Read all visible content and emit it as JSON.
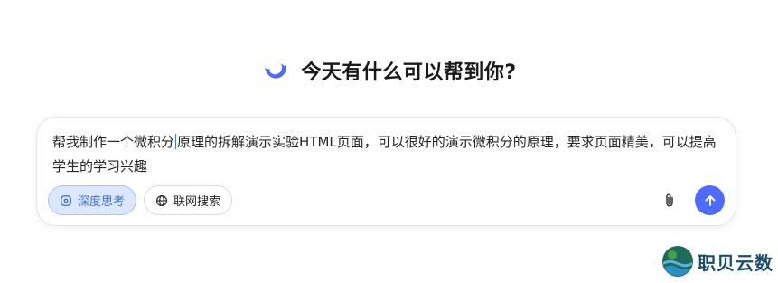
{
  "header": {
    "title": "今天有什么可以帮到你?",
    "logo_icon": "whale-logo-icon"
  },
  "composer": {
    "text_before_caret": "帮我制作一个微积分",
    "text_after_caret": "原理的拆解演示实验HTML页面，可以很好的演示微积分的原理，要求页面精美，可以提高学生的学习兴趣",
    "deep_think_label": "深度思考",
    "web_search_label": "联网搜索",
    "attach_icon": "paperclip-icon",
    "send_icon": "arrow-up-icon"
  },
  "watermark": {
    "name": "职贝云数"
  },
  "colors": {
    "accent": "#4d6bfe",
    "deep_think_bg": "#dbe7fd",
    "deep_think_text": "#3f6ed8",
    "watermark_text": "#1a4c6b"
  }
}
